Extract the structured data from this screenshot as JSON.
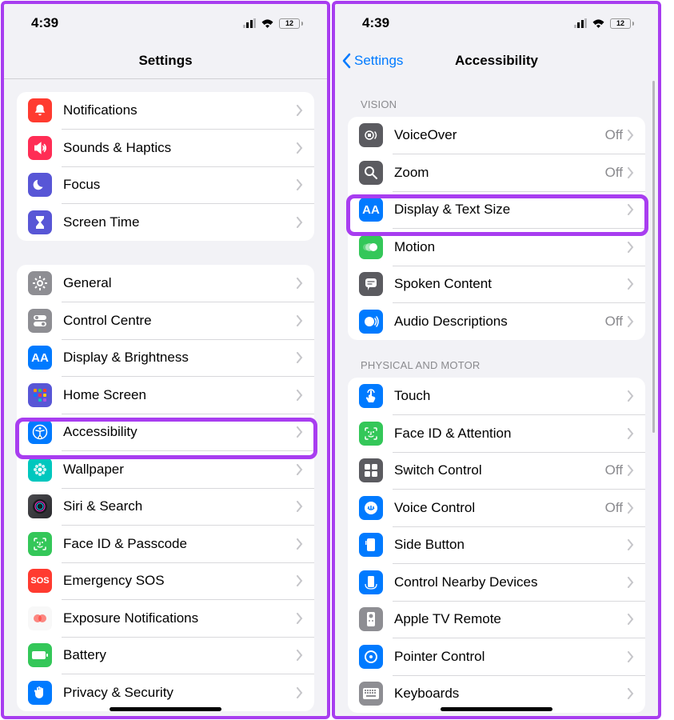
{
  "status": {
    "time": "4:39",
    "battery": "12"
  },
  "left": {
    "title": "Settings",
    "group1": [
      {
        "label": "Notifications",
        "icon": "bell-icon",
        "bg": "bg-red"
      },
      {
        "label": "Sounds & Haptics",
        "icon": "speaker-icon",
        "bg": "bg-pink"
      },
      {
        "label": "Focus",
        "icon": "moon-icon",
        "bg": "bg-indigo"
      },
      {
        "label": "Screen Time",
        "icon": "hourglass-icon",
        "bg": "bg-indigo"
      }
    ],
    "group2": [
      {
        "label": "General",
        "icon": "gear-icon",
        "bg": "bg-gray"
      },
      {
        "label": "Control Centre",
        "icon": "toggles-icon",
        "bg": "bg-gray"
      },
      {
        "label": "Display & Brightness",
        "icon": "aa-icon",
        "bg": "bg-blue"
      },
      {
        "label": "Home Screen",
        "icon": "grid-icon",
        "bg": "bg-indigo"
      },
      {
        "label": "Accessibility",
        "icon": "accessibility-icon",
        "bg": "bg-blue"
      },
      {
        "label": "Wallpaper",
        "icon": "flower-icon",
        "bg": "bg-teal"
      },
      {
        "label": "Siri & Search",
        "icon": "siri-icon",
        "bg": "bg-siri"
      },
      {
        "label": "Face ID & Passcode",
        "icon": "faceid-icon",
        "bg": "bg-green"
      },
      {
        "label": "Emergency SOS",
        "icon": "sos-icon",
        "bg": "bg-red"
      },
      {
        "label": "Exposure Notifications",
        "icon": "exposure-icon",
        "bg": "bg-white"
      },
      {
        "label": "Battery",
        "icon": "battery-icon",
        "bg": "bg-green"
      },
      {
        "label": "Privacy & Security",
        "icon": "hand-icon",
        "bg": "bg-blue"
      }
    ]
  },
  "right": {
    "back": "Settings",
    "title": "Accessibility",
    "sec1": "VISION",
    "vision": [
      {
        "label": "VoiceOver",
        "status": "Off",
        "icon": "voiceover-icon",
        "bg": "bg-grayd"
      },
      {
        "label": "Zoom",
        "status": "Off",
        "icon": "zoom-icon",
        "bg": "bg-grayd"
      },
      {
        "label": "Display & Text Size",
        "status": "",
        "icon": "aa-icon",
        "bg": "bg-blue"
      },
      {
        "label": "Motion",
        "status": "",
        "icon": "motion-icon",
        "bg": "bg-green"
      },
      {
        "label": "Spoken Content",
        "status": "",
        "icon": "speech-icon",
        "bg": "bg-grayd"
      },
      {
        "label": "Audio Descriptions",
        "status": "Off",
        "icon": "audio-desc-icon",
        "bg": "bg-blue"
      }
    ],
    "sec2": "PHYSICAL AND MOTOR",
    "motor": [
      {
        "label": "Touch",
        "status": "",
        "icon": "touch-icon",
        "bg": "bg-blue"
      },
      {
        "label": "Face ID & Attention",
        "status": "",
        "icon": "faceid-icon",
        "bg": "bg-green"
      },
      {
        "label": "Switch Control",
        "status": "Off",
        "icon": "switch-icon",
        "bg": "bg-grayd"
      },
      {
        "label": "Voice Control",
        "status": "Off",
        "icon": "voice-icon",
        "bg": "bg-blue"
      },
      {
        "label": "Side Button",
        "status": "",
        "icon": "sidebtn-icon",
        "bg": "bg-blue"
      },
      {
        "label": "Control Nearby Devices",
        "status": "",
        "icon": "nearby-icon",
        "bg": "bg-blue"
      },
      {
        "label": "Apple TV Remote",
        "status": "",
        "icon": "remote-icon",
        "bg": "bg-gray"
      },
      {
        "label": "Pointer Control",
        "status": "",
        "icon": "pointer-icon",
        "bg": "bg-blue"
      },
      {
        "label": "Keyboards",
        "status": "",
        "icon": "keyboard-icon",
        "bg": "bg-gray"
      }
    ]
  }
}
